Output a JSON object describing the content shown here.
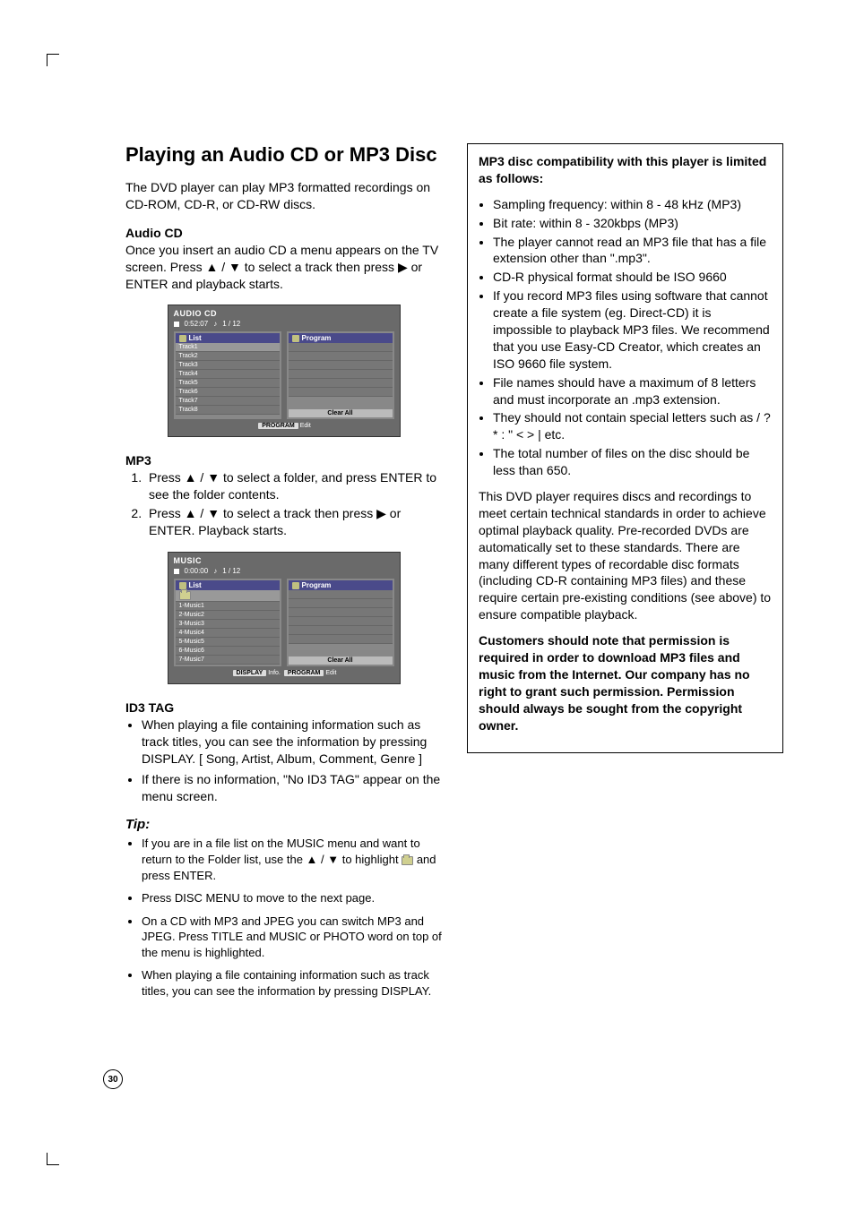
{
  "page_number": "30",
  "title": "Playing an Audio CD or MP3 Disc",
  "intro": "The DVD player can play MP3 formatted recordings on CD-ROM, CD-R, or CD-RW discs.",
  "audio_cd": {
    "heading": "Audio CD",
    "body": "Once you insert an audio CD a menu appears on the TV screen. Press ▲ / ▼ to select a track then press ▶ or ENTER and playback starts."
  },
  "osd1": {
    "title": "AUDIO CD",
    "time": "0:52:07",
    "counter": "1 / 12",
    "list_label": "List",
    "program_label": "Program",
    "tracks": [
      "Track1",
      "Track2",
      "Track3",
      "Track4",
      "Track5",
      "Track6",
      "Track7",
      "Track8"
    ],
    "clear_all": "Clear All",
    "footer_btn": "PROGRAM",
    "footer_txt": "Edit"
  },
  "mp3": {
    "heading": "MP3",
    "step1": "Press ▲ / ▼ to select a folder, and press ENTER to see the folder contents.",
    "step2": "Press ▲ / ▼ to select a track then press ▶ or ENTER. Playback starts."
  },
  "osd2": {
    "title": "MUSIC",
    "time": "0:00:00",
    "counter": "1 / 12",
    "list_label": "List",
    "program_label": "Program",
    "tracks": [
      "1-Music1",
      "2-Music2",
      "3-Music3",
      "4-Music4",
      "5-Music5",
      "6-Music6",
      "7-Music7"
    ],
    "clear_all": "Clear All",
    "footer_btn1": "DISPLAY",
    "footer_txt1": "Info.",
    "footer_btn2": "PROGRAM",
    "footer_txt2": "Edit"
  },
  "id3": {
    "heading": "ID3 TAG",
    "b1": "When playing a file containing information such as track titles, you can see the information by pressing DISPLAY. [ Song, Artist, Album, Comment, Genre ]",
    "b2": "If there is no information, \"No ID3 TAG\" appear on the menu screen."
  },
  "tip": {
    "heading": "Tip:",
    "t1a": "If you are in a file list on the MUSIC menu and want to return to the Folder list, use the ▲ / ▼ to highlight ",
    "t1b": " and press ENTER.",
    "t2": "Press DISC MENU to move to the next page.",
    "t3": "On a CD with MP3 and JPEG you can switch MP3 and JPEG. Press TITLE and MUSIC or PHOTO word on top of the menu is highlighted.",
    "t4": "When playing a file containing information such as track titles, you can see the information by pressing DISPLAY."
  },
  "box": {
    "h": "MP3 disc compatibility with this player is limited as follows:",
    "c1": "Sampling frequency: within 8 - 48 kHz (MP3)",
    "c2": "Bit rate: within 8 - 320kbps (MP3)",
    "c3": "The player cannot read an MP3 file that has a file extension other than \".mp3\".",
    "c4": "CD-R physical format should be ISO 9660",
    "c5": "If you record MP3  files using software that cannot create a file system (eg. Direct-CD) it is impossible to playback MP3 files. We recommend that you use Easy-CD Creator, which creates an ISO 9660 file system.",
    "c6": "File names should have a maximum of 8 letters and must incorporate an .mp3 extension.",
    "c7": "They should not contain special letters such as  / ? * : \" < > | etc.",
    "c8": "The total number of files on the disc should be less than 650.",
    "p1": "This DVD player requires discs and recordings to meet certain technical standards in order to achieve optimal playback quality. Pre-recorded DVDs are automatically set to these standards. There are many different types of recordable disc formats (including CD-R containing MP3 files) and these require certain pre-existing conditions (see above) to ensure compatible playback.",
    "p2": "Customers should note that permission is required in order to download MP3 files and music from the Internet. Our company has no right to grant such permission. Permission should always be sought from the copyright owner."
  }
}
